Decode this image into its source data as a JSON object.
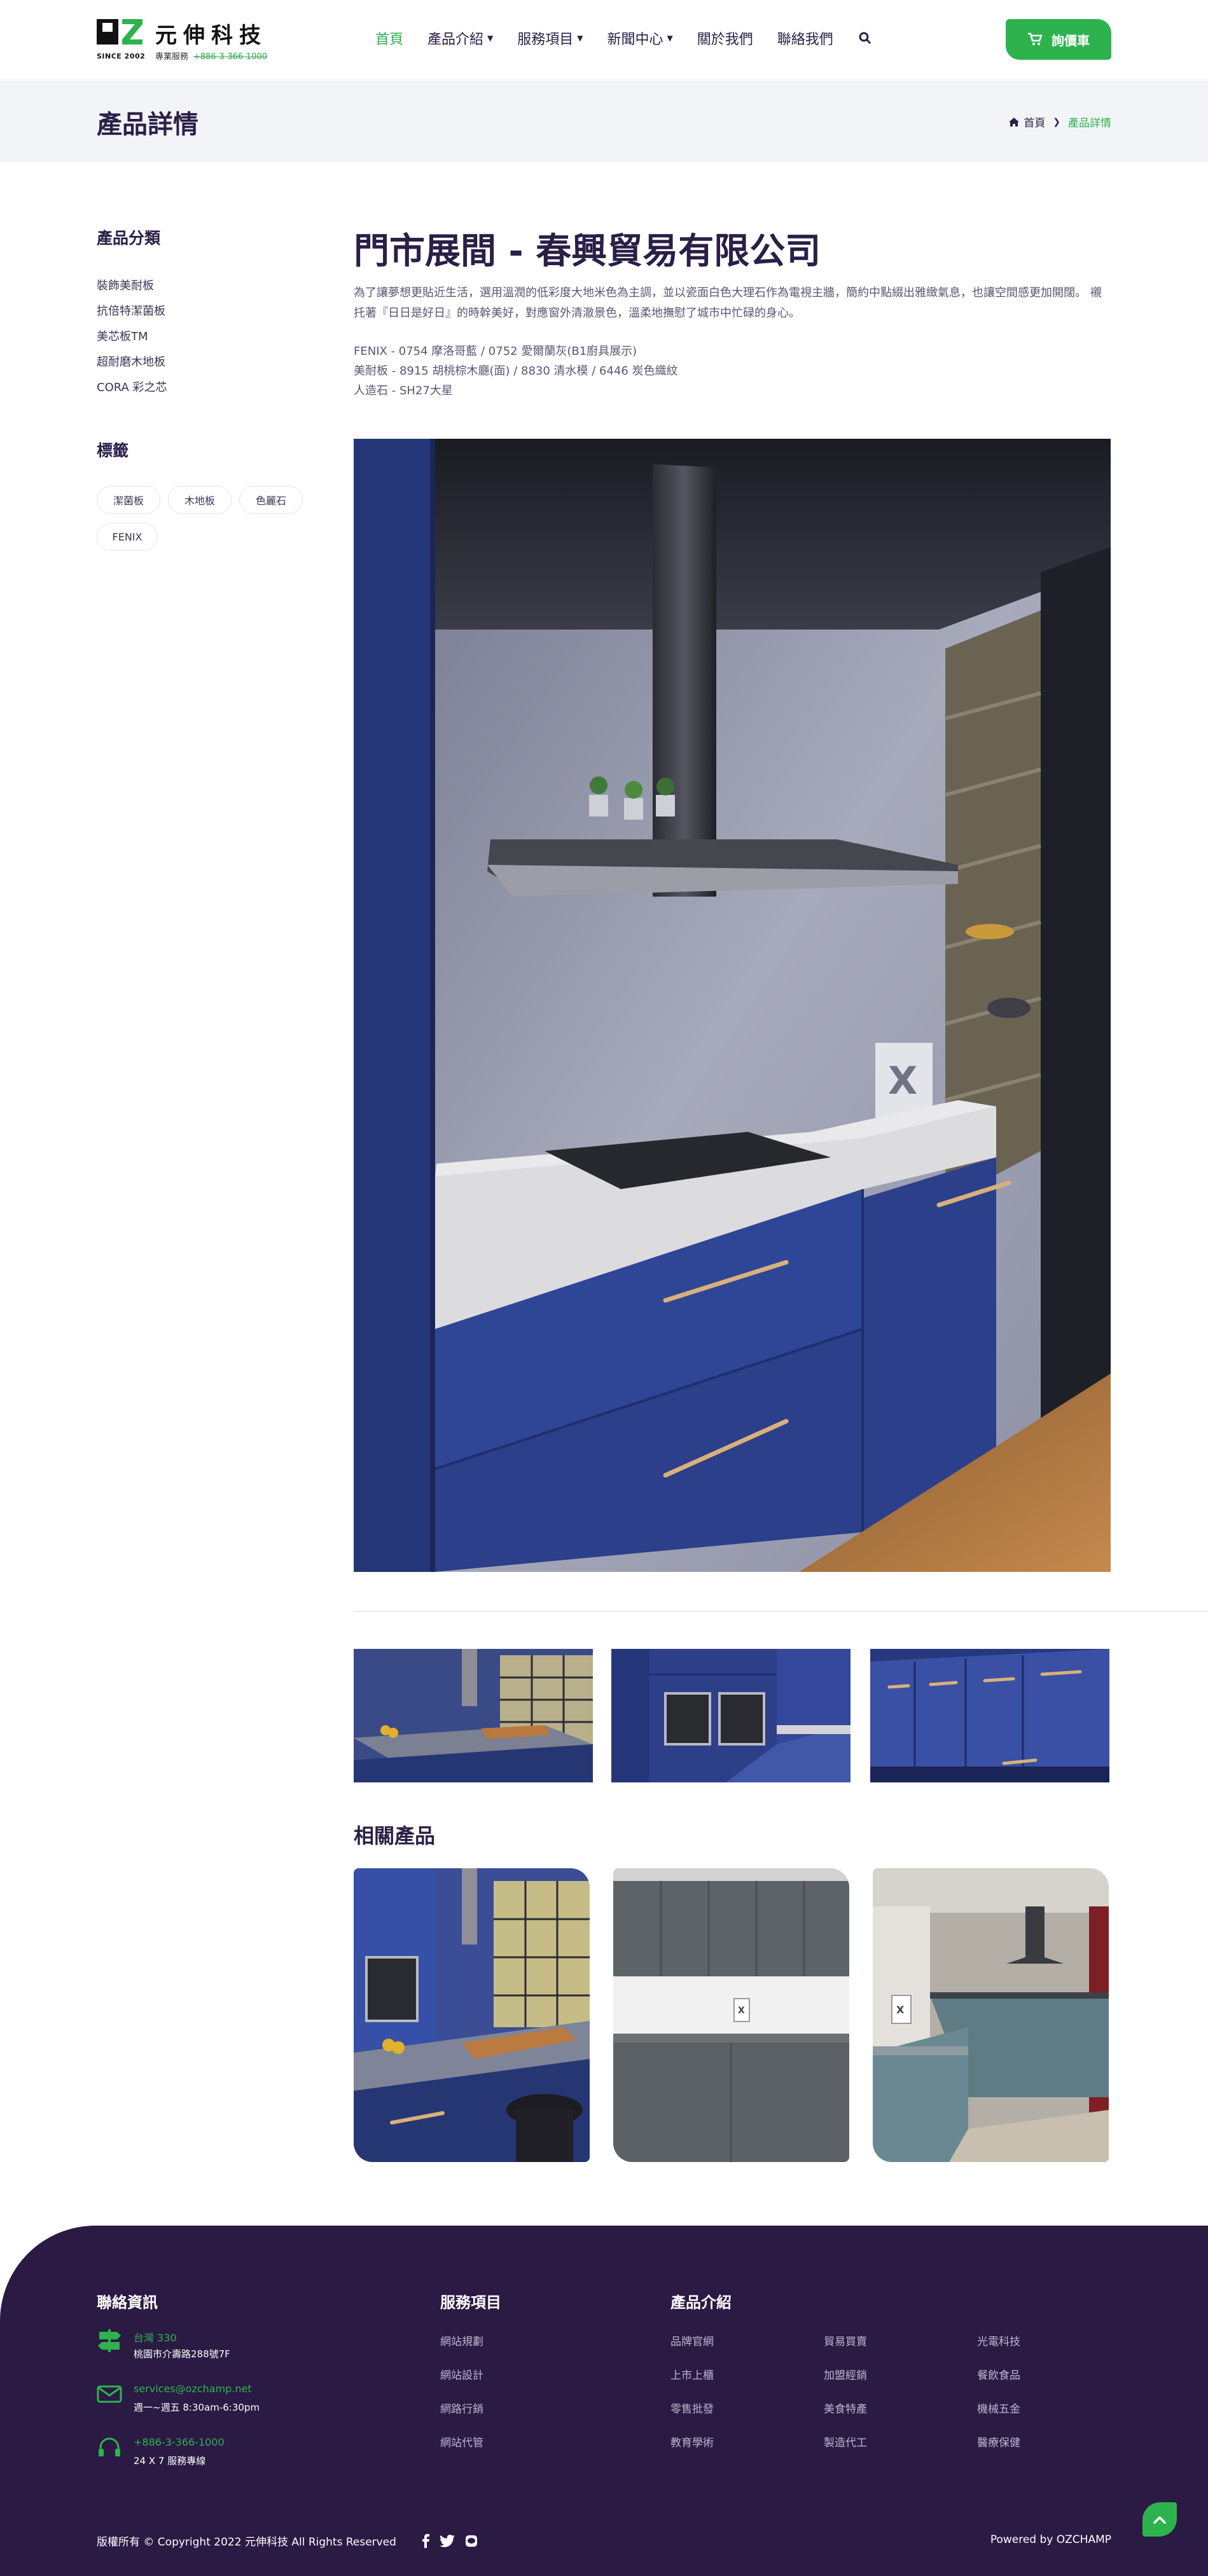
{
  "header": {
    "logo_since": "SINCE 2002",
    "logo_name": "元伸科技",
    "logo_sub": "專業服務",
    "logo_phone": "+886-3-366-1000",
    "nav": [
      {
        "label": "首頁"
      },
      {
        "label": "產品介紹"
      },
      {
        "label": "服務項目"
      },
      {
        "label": "新聞中心"
      },
      {
        "label": "關於我們"
      },
      {
        "label": "聯絡我們"
      }
    ],
    "cart_label": "詢價車",
    "accent_color": "#2eb24e"
  },
  "titlebar": {
    "page_title": "產品詳情",
    "breadcrumb_home": "首頁",
    "breadcrumb_current": "產品詳情"
  },
  "sidebar": {
    "categories_title": "產品分類",
    "categories": [
      "裝飾美耐板",
      "抗倍特潔菌板",
      "美芯板TM",
      "超耐磨木地板",
      "CORA 彩之芯"
    ],
    "tags_title": "標籤",
    "tags": [
      "潔菌板",
      "木地板",
      "色麗石",
      "FENIX"
    ]
  },
  "product": {
    "title": "門市展間 - 春興貿易有限公司",
    "description": "為了讓夢想更貼近生活，選用溫潤的低彩度大地米色為主調，並以瓷面白色大理石作為電視主牆，簡約中點綴出雅緻氣息，也讓空間感更加開闊。 襯托著『日日是好日』的時幹美好，對應窗外清澈景色，溫柔地撫慰了城市中忙碌的身心。",
    "specs": [
      "FENIX - 0754 摩洛哥藍 / 0752 愛爾蘭灰(B1廚具展示)",
      "美耐板 - 8915 胡桃棕木廳(面) / 8830 清水模 / 6446 炭色織紋",
      "人造石 - SH27大星"
    ]
  },
  "gallery": {
    "hero_icon": "kitchen-photo",
    "thumbnails": [
      "kitchen-island-thumb",
      "oven-cabinet-thumb",
      "blue-drawers-thumb"
    ]
  },
  "related": {
    "title": "相關產品",
    "items": [
      "blue-kitchen-photo",
      "grey-kitchen-photo",
      "teal-kitchen-photo"
    ]
  },
  "footer": {
    "contact_title": "聯絡資訊",
    "contacts": [
      {
        "line1": "台灣 330",
        "line2": "桃園市介壽路288號7F"
      },
      {
        "line1": "services@ozchamp.net",
        "line2": "週一~週五 8:30am-6:30pm"
      },
      {
        "line1": "+886-3-366-1000",
        "line2": "24 X 7 服務專線"
      }
    ],
    "services_title": "服務項目",
    "services": [
      "網站規劃",
      "網站設計",
      "網路行銷",
      "網站代管"
    ],
    "products_title": "產品介紹",
    "products": [
      "品牌官網",
      "上市上櫃",
      "零售批發",
      "教育學術",
      "貿易買賣",
      "加盟經銷",
      "美食特產",
      "製造代工",
      "光電科技",
      "餐飲食品",
      "機械五金",
      "醫療保健"
    ],
    "copyright": "版權所有 © Copyright 2022 元伸科技 All Rights Reserved",
    "powered": "Powered by OZCHAMP"
  }
}
